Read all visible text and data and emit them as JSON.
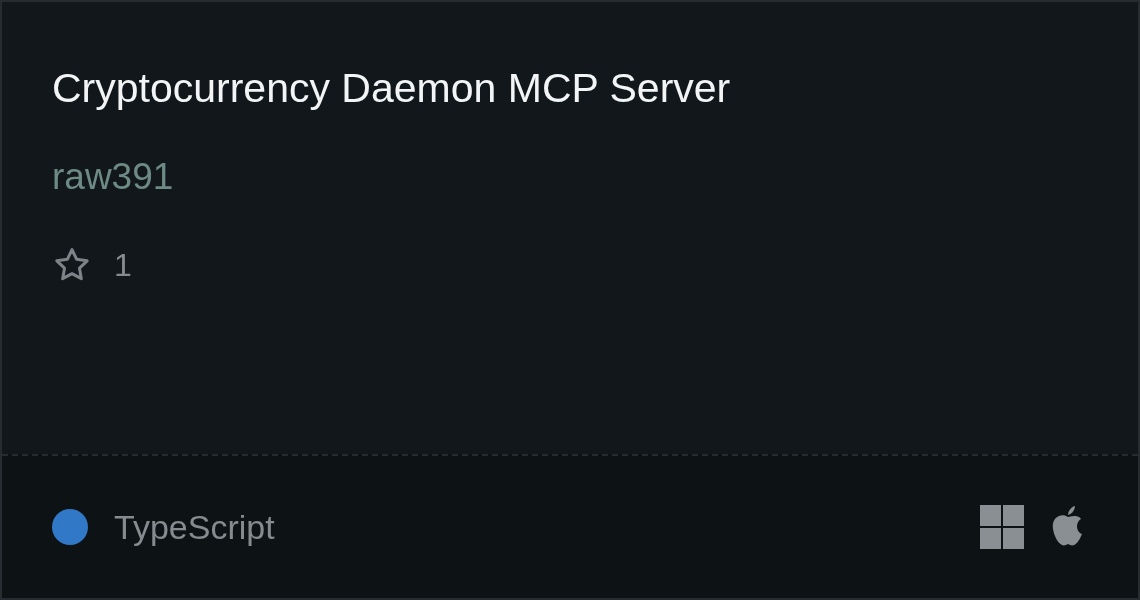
{
  "card": {
    "title": "Cryptocurrency Daemon MCP Server",
    "author": "raw391",
    "star_count": "1",
    "language": {
      "name": "TypeScript",
      "color": "#3178c6"
    },
    "platforms": [
      {
        "kind": "windows"
      },
      {
        "kind": "apple"
      }
    ]
  }
}
